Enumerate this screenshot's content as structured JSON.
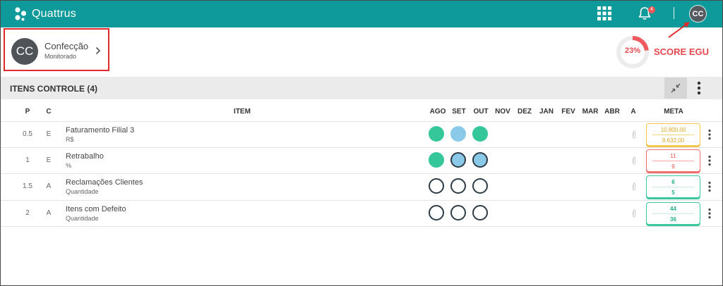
{
  "app": {
    "name": "Quattrus"
  },
  "header": {
    "notifications_count": "4",
    "user_initials": "CC"
  },
  "unit": {
    "initials": "CC",
    "name": "Confecção",
    "status": "Monitorado"
  },
  "score": {
    "value": "23%",
    "percent": 23,
    "label": "SCORE EGU"
  },
  "section": {
    "title": "ITENS CONTROLE (4)"
  },
  "table": {
    "columns": {
      "p": "P",
      "c": "C",
      "item": "ITEM",
      "months": [
        "AGO",
        "SET",
        "OUT",
        "NOV",
        "DEZ",
        "JAN",
        "FEV",
        "MAR",
        "ABR"
      ],
      "a": "A",
      "meta": "META"
    },
    "rows": [
      {
        "p": "0.5",
        "c": "E",
        "name": "Faturamento Filial 3",
        "unit": "R$",
        "status": [
          "green",
          "blue",
          "green"
        ],
        "meta_top": "10.800,00",
        "meta_bottom": "9.632,00",
        "meta_color": "yellow"
      },
      {
        "p": "1",
        "c": "E",
        "name": "Retrabalho",
        "unit": "%",
        "status": [
          "green",
          "blue-out",
          "blue-out"
        ],
        "meta_top": "11",
        "meta_bottom": "9",
        "meta_color": "red"
      },
      {
        "p": "1.5",
        "c": "A",
        "name": "Reclamações Clientes",
        "unit": "Quantidade",
        "status": [
          "empty",
          "empty",
          "empty"
        ],
        "meta_top": "6",
        "meta_bottom": "5",
        "meta_color": "teal"
      },
      {
        "p": "2",
        "c": "A",
        "name": "Itens com Defeito",
        "unit": "Quantidade",
        "status": [
          "empty",
          "empty",
          "empty"
        ],
        "meta_top": "44",
        "meta_bottom": "36",
        "meta_color": "teal"
      }
    ]
  }
}
